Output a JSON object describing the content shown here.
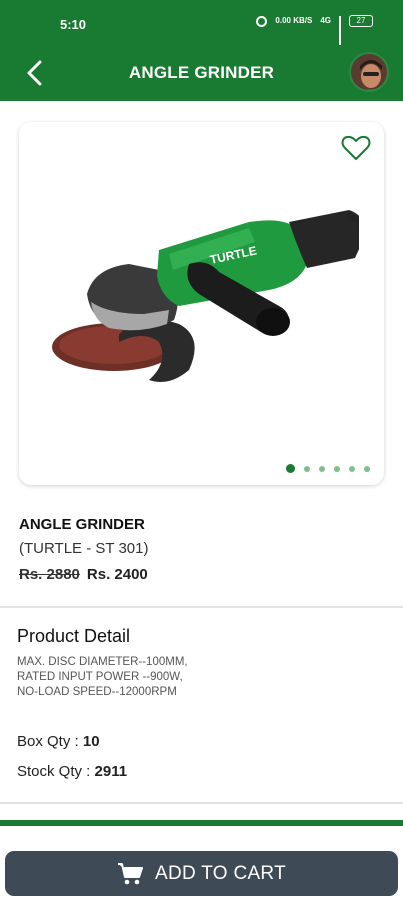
{
  "status_bar": {
    "time": "5:10",
    "network_speed": "0.00 KB/S",
    "network_type": "4G",
    "battery": "27"
  },
  "header": {
    "title": "ANGLE GRINDER",
    "back_icon": "chevron-left-icon",
    "avatar_icon": "user-avatar"
  },
  "product": {
    "image_brand": "TURTLE",
    "name": "ANGLE GRINDER",
    "model": "(TURTLE - ST 301)",
    "old_price": "Rs. 2880",
    "price": "Rs. 2400",
    "carousel": {
      "total": 6,
      "active_index": 0
    }
  },
  "details": {
    "heading": "Product Detail",
    "lines": [
      "MAX. DISC DIAMETER--100MM,",
      "RATED INPUT POWER --900W,",
      "NO-LOAD SPEED--12000RPM"
    ],
    "box_qty_label": "Box Qty :",
    "box_qty_value": "10",
    "stock_qty_label": "Stock Qty :",
    "stock_qty_value": "2911"
  },
  "cart": {
    "label": "ADD TO CART",
    "icon": "cart-icon"
  },
  "colors": {
    "brand_green": "#197a31",
    "cart_button": "#3e4a55"
  }
}
